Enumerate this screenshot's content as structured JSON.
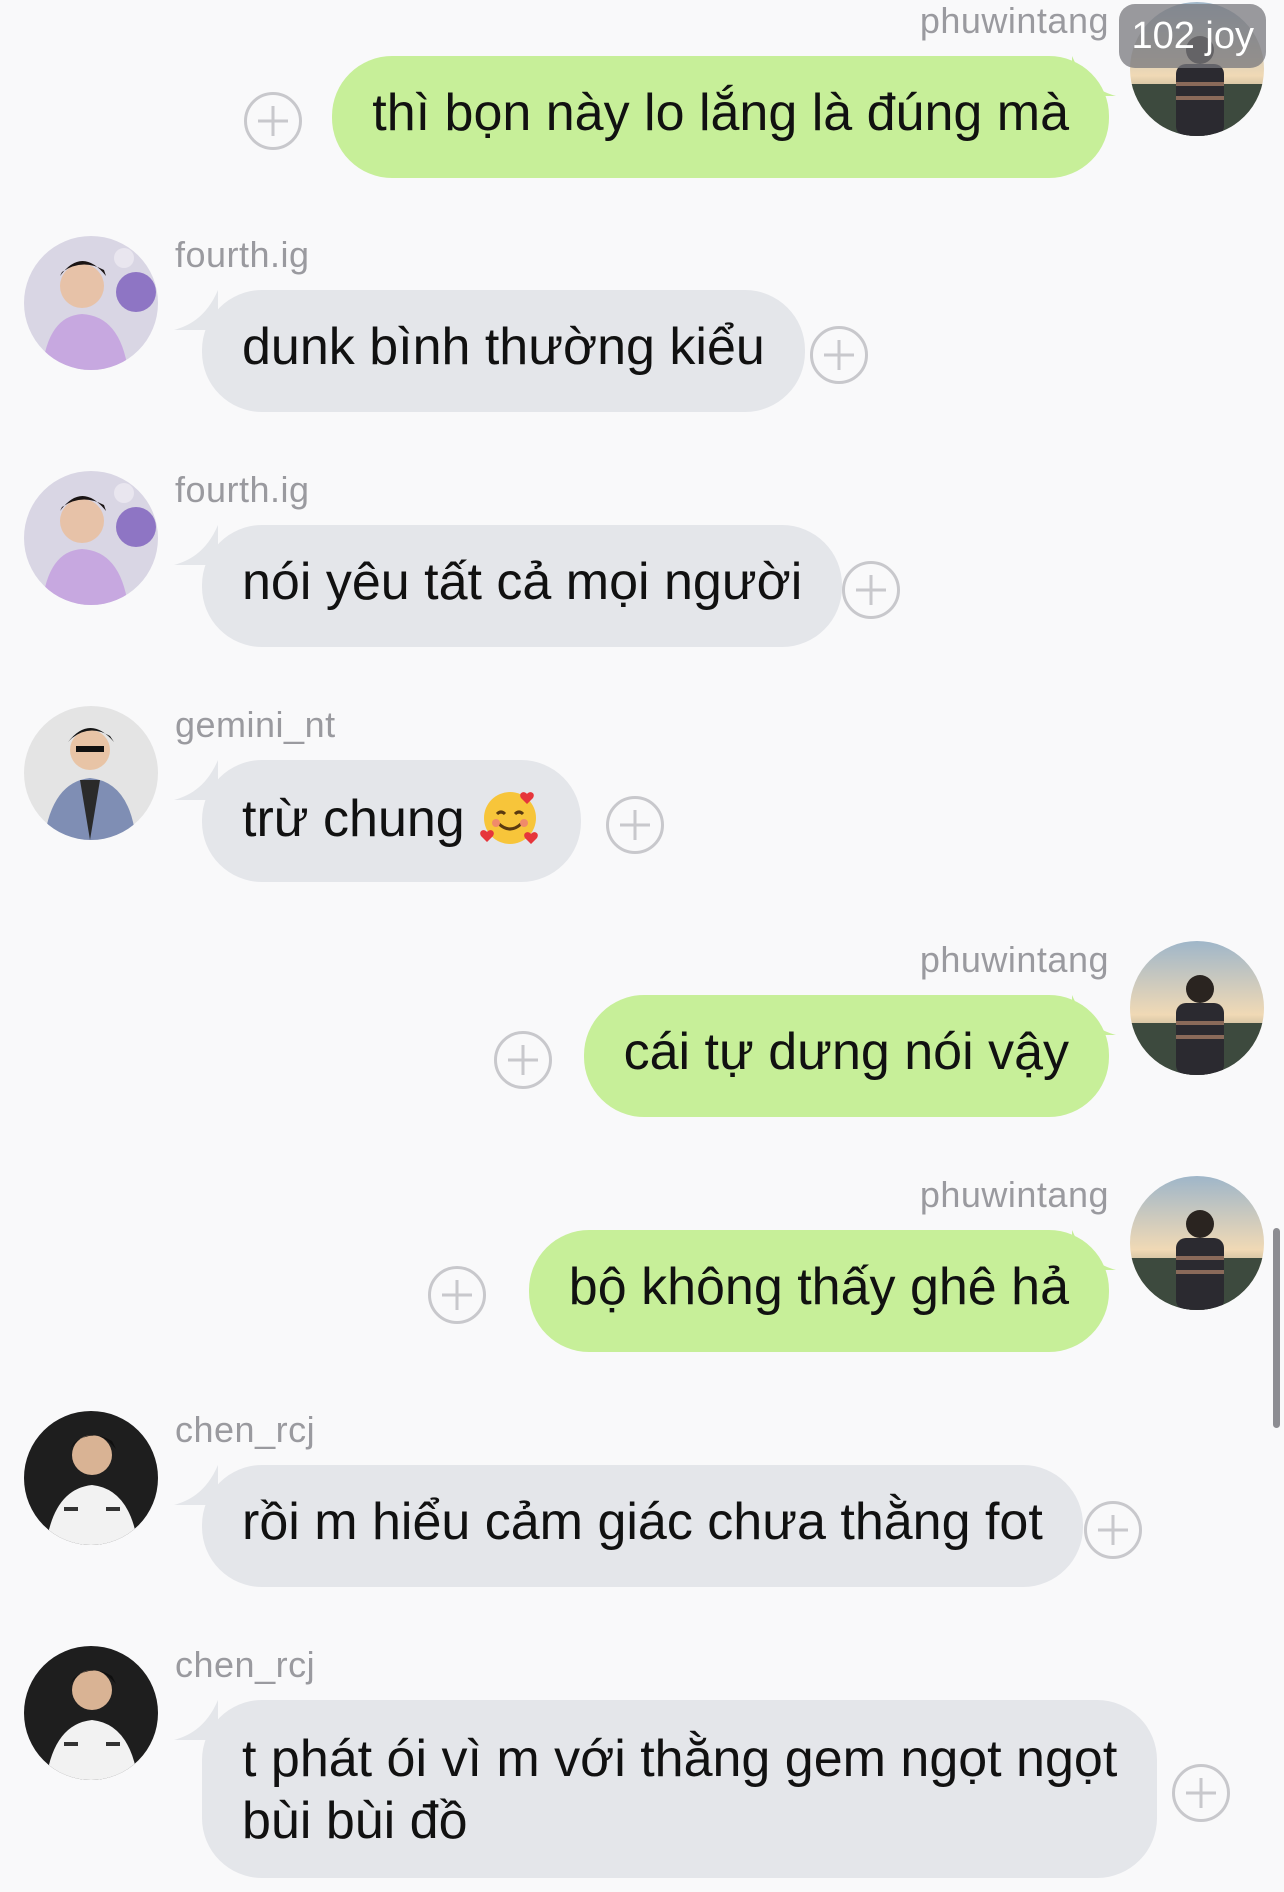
{
  "messages": [
    {
      "sender": "phuwintang",
      "text": "thì bọn này lo lắng là đúng mà",
      "dir": "out"
    },
    {
      "sender": "fourth.ig",
      "text": "dunk bình thường kiểu",
      "dir": "in"
    },
    {
      "sender": "fourth.ig",
      "text": "nói yêu tất cả mọi người",
      "dir": "in"
    },
    {
      "sender": "gemini_nt",
      "text": "trừ chung",
      "dir": "in",
      "emoji": "smiling-face-with-hearts-icon"
    },
    {
      "sender": "phuwintang",
      "text": "cái tự dưng nói vậy",
      "dir": "out"
    },
    {
      "sender": "phuwintang",
      "text": "bộ không thấy ghê hả",
      "dir": "out"
    },
    {
      "sender": "chen_rcj",
      "text": "rồi m hiểu cảm giác chưa thằng fot",
      "dir": "in"
    },
    {
      "sender": "chen_rcj",
      "text_line1": "t phát ói vì m với thằng gem ngọt ngọt",
      "text_line2": "bùi bùi đồ",
      "dir": "in"
    }
  ],
  "overlay": {
    "badge": "102 joy"
  },
  "colors": {
    "outgoing": "#c7ef99",
    "incoming": "#e4e6ea",
    "background": "#f9f9fa"
  }
}
